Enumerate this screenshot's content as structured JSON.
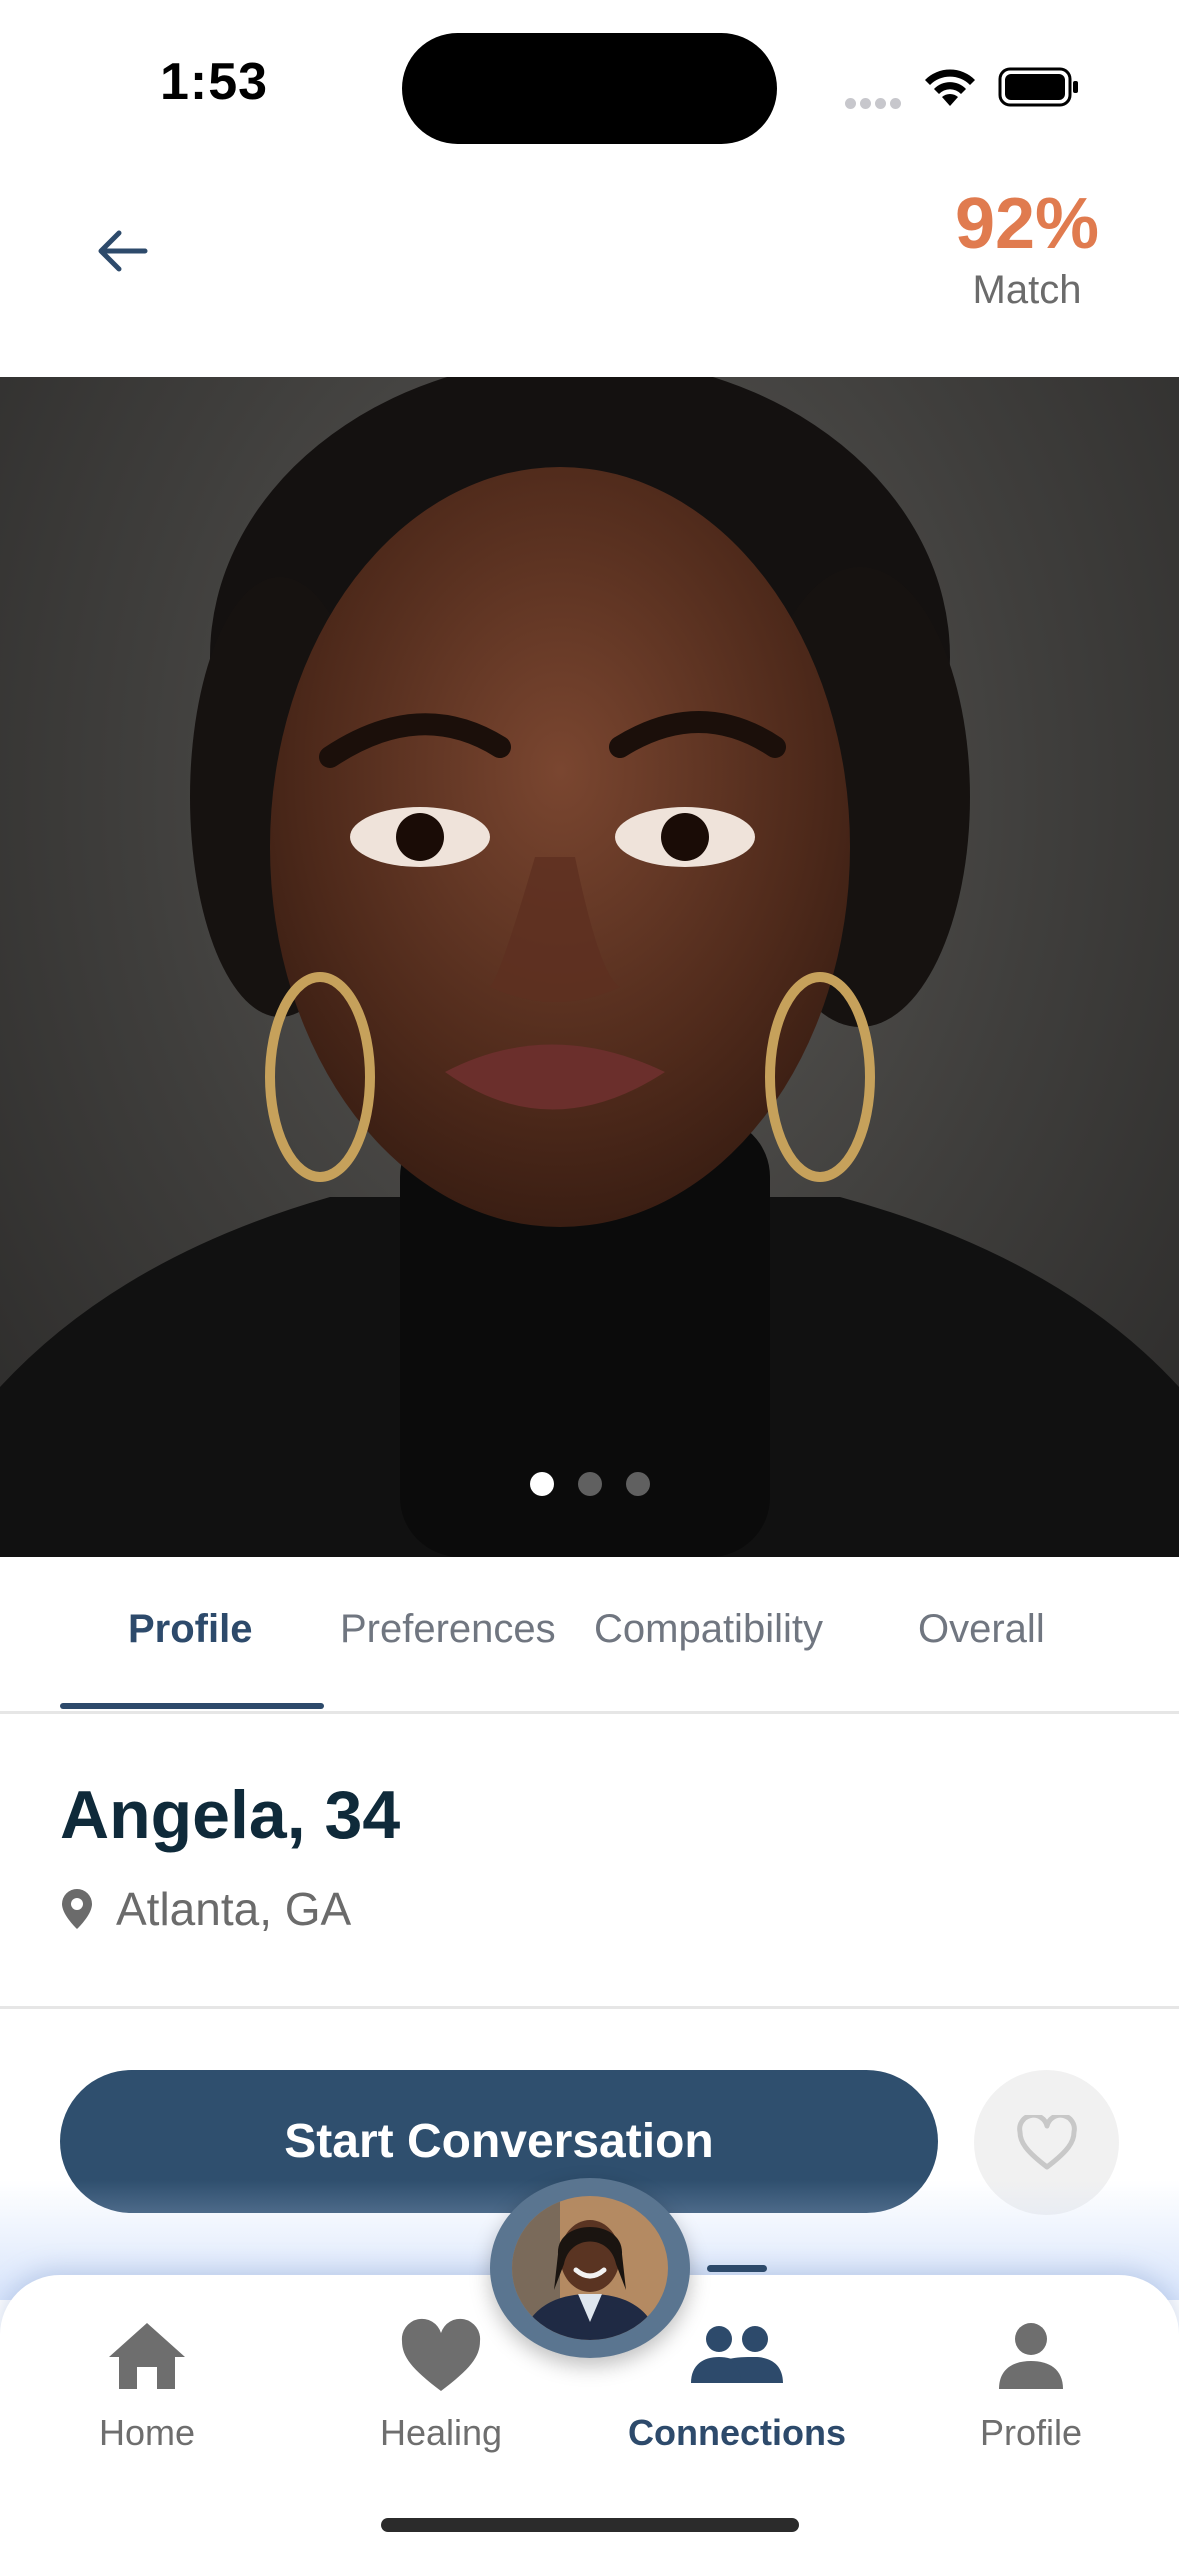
{
  "status_bar": {
    "time": "1:53"
  },
  "header": {
    "match_percent": "92%",
    "match_label": "Match"
  },
  "photo": {
    "pages": 3,
    "current_page": 1
  },
  "tabs": [
    {
      "label": "Profile",
      "active": true
    },
    {
      "label": "Preferences",
      "active": false
    },
    {
      "label": "Compatibility",
      "active": false
    },
    {
      "label": "Overall",
      "active": false
    }
  ],
  "profile": {
    "name_age": "Angela, 34",
    "location": "Atlanta, GA"
  },
  "actions": {
    "start_label": "Start Conversation"
  },
  "nav": [
    {
      "label": "Home",
      "icon": "home-icon"
    },
    {
      "label": "Healing",
      "icon": "heart-icon"
    },
    {
      "label": "Connections",
      "icon": "people-icon",
      "active": true
    },
    {
      "label": "Profile",
      "icon": "person-icon"
    }
  ],
  "colors": {
    "accent": "#2f4f6e",
    "match": "#e07b4f",
    "name": "#0f2a3a"
  }
}
